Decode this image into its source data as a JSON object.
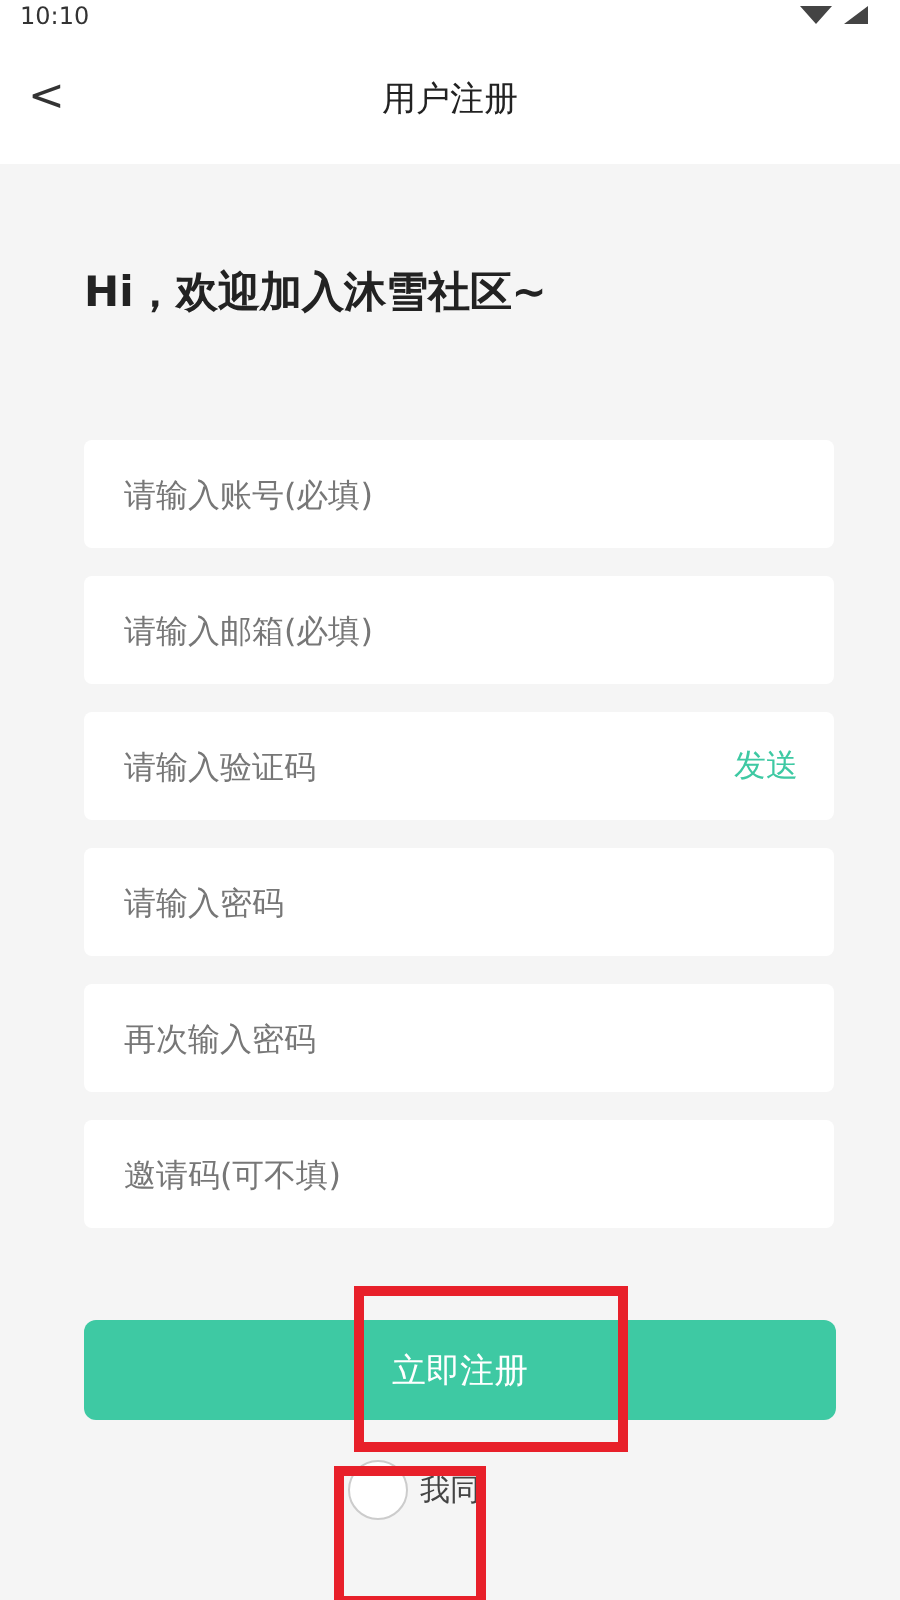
{
  "status_bar": {
    "time": "10:10"
  },
  "header": {
    "back": "<",
    "title": "用户注册"
  },
  "greeting": "Hi，欢迎加入沐雪社区~",
  "fields": [
    {
      "kind": "input",
      "placeholder": "请输入账号(必填)"
    },
    {
      "kind": "input",
      "placeholder": "请输入邮箱(必填)"
    },
    {
      "kind": "input_with_action",
      "placeholder": "请输入验证码",
      "action": "发送"
    },
    {
      "kind": "input",
      "placeholder": "请输入密码"
    },
    {
      "kind": "input",
      "placeholder": "再次输入密码"
    },
    {
      "kind": "input",
      "placeholder": "邀请码(可不填)"
    }
  ],
  "submit": "立即注册",
  "agreement": {
    "checked": false,
    "text": "我同"
  }
}
